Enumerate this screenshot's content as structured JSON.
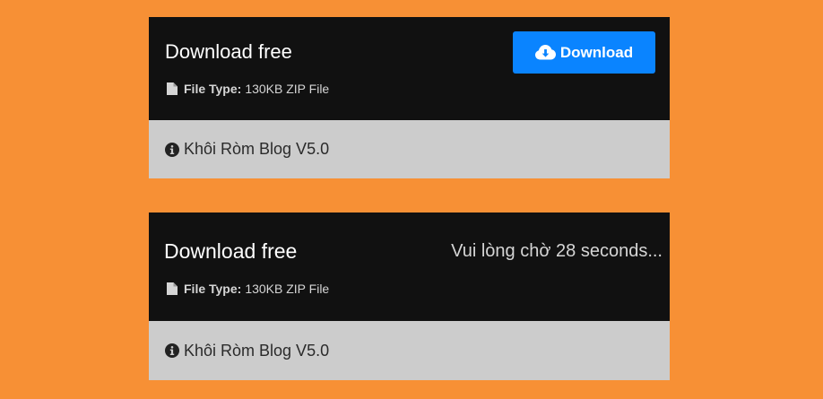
{
  "cards": [
    {
      "title": "Download free",
      "file_type_label": "File Type:",
      "file_type_value": "130KB ZIP File",
      "button_label": "Download",
      "footer_text": "Khôi Ròm Blog V5.0"
    },
    {
      "title": "Download free",
      "file_type_label": "File Type:",
      "file_type_value": "130KB ZIP File",
      "wait_text": "Vui lòng chờ 28 seconds...",
      "footer_text": "Khôi Ròm Blog V5.0"
    }
  ],
  "icons": {
    "file": "file-icon",
    "download": "cloud-download-icon",
    "info": "info-icon"
  },
  "colors": {
    "page_background": "#f79035",
    "card_header": "#111111",
    "card_footer": "#cccccc",
    "button": "#0a84ff"
  }
}
